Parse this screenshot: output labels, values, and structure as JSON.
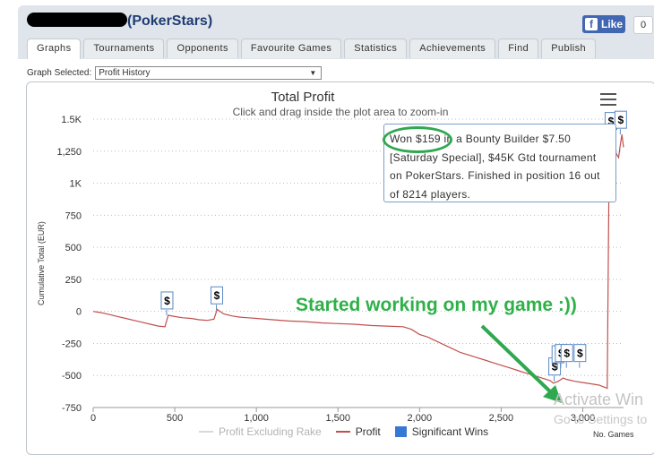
{
  "header": {
    "site_name": "(PokerStars)",
    "like_label": "Like",
    "like_count": "0",
    "fb_icon": "f"
  },
  "tabs": [
    {
      "label": "Graphs",
      "active": true
    },
    {
      "label": "Tournaments",
      "active": false
    },
    {
      "label": "Opponents",
      "active": false
    },
    {
      "label": "Favourite Games",
      "active": false
    },
    {
      "label": "Statistics",
      "active": false
    },
    {
      "label": "Achievements",
      "active": false
    },
    {
      "label": "Find",
      "active": false
    },
    {
      "label": "Publish",
      "active": false
    }
  ],
  "graph_selector": {
    "label": "Graph Selected:",
    "value": "Profit History"
  },
  "tooltip": {
    "text": "Won $159 in a Bounty Builder $7.50 [Saturday Special], $45K Gtd tournament on PokerStars. Finished in position 16 out of 8214 players."
  },
  "annotation": {
    "text": "Started working on my game :))"
  },
  "watermark": {
    "line1": "Activate Win",
    "line2": "Go to Settings to"
  },
  "chart_data": {
    "type": "line",
    "title": "Total Profit",
    "subtitle": "Click and drag inside the plot area to zoom-in",
    "xlabel": "No. Games",
    "ylabel": "Cumulative Total (EUR)",
    "xlim": [
      0,
      3250
    ],
    "ylim": [
      -750,
      1500
    ],
    "x_ticks": [
      0,
      500,
      1000,
      1500,
      2000,
      2500,
      3000
    ],
    "x_tick_labels": [
      "0",
      "500",
      "1,000",
      "1,500",
      "2,000",
      "2,500",
      "3,000"
    ],
    "y_ticks": [
      -750,
      -500,
      -250,
      0,
      250,
      500,
      750,
      1000,
      1250,
      1500
    ],
    "y_tick_labels": [
      "-750",
      "-500",
      "-250",
      "0",
      "250",
      "500",
      "750",
      "1K",
      "1,250",
      "1.5K"
    ],
    "grid": "horizontal dotted",
    "legend": [
      "Profit Excluding Rake",
      "Profit",
      "Significant Wins"
    ],
    "legend_position": "bottom-center",
    "series": [
      {
        "name": "Profit",
        "color": "#c0504d",
        "x": [
          0,
          50,
          100,
          150,
          200,
          250,
          300,
          350,
          400,
          440,
          460,
          500,
          550,
          600,
          650,
          700,
          740,
          760,
          800,
          850,
          900,
          950,
          1000,
          1100,
          1200,
          1300,
          1400,
          1500,
          1600,
          1700,
          1800,
          1900,
          1950,
          2000,
          2050,
          2100,
          2150,
          2200,
          2250,
          2300,
          2350,
          2400,
          2450,
          2500,
          2550,
          2600,
          2650,
          2700,
          2750,
          2800,
          2820,
          2850,
          2880,
          2900,
          2950,
          3000,
          3050,
          3100,
          3130,
          3150,
          3160,
          3170,
          3180,
          3200,
          3210,
          3220,
          3230,
          3240,
          3250
        ],
        "y": [
          0,
          -10,
          -25,
          -40,
          -55,
          -70,
          -85,
          -100,
          -115,
          -120,
          -30,
          -40,
          -50,
          -55,
          -65,
          -70,
          -60,
          15,
          -20,
          -35,
          -45,
          -50,
          -55,
          -65,
          -75,
          -80,
          -90,
          -95,
          -100,
          -110,
          -115,
          -120,
          -140,
          -180,
          -200,
          -230,
          -260,
          -290,
          -320,
          -340,
          -360,
          -380,
          -400,
          -420,
          -440,
          -460,
          -480,
          -500,
          -520,
          -540,
          -560,
          -545,
          -520,
          -530,
          -545,
          -555,
          -565,
          -575,
          -590,
          -600,
          900,
          1370,
          1300,
          1250,
          1220,
          1200,
          1300,
          1380,
          1280
        ]
      }
    ],
    "significant_wins": [
      {
        "x": 450,
        "y": -30,
        "label": "$"
      },
      {
        "x": 755,
        "y": 10,
        "label": "$"
      },
      {
        "x": 2825,
        "y": -545,
        "label": "$"
      },
      {
        "x": 2845,
        "y": -450,
        "label": "$"
      },
      {
        "x": 2865,
        "y": -440,
        "label": "$"
      },
      {
        "x": 2900,
        "y": -440,
        "label": "$"
      },
      {
        "x": 2980,
        "y": -440,
        "label": "$"
      },
      {
        "x": 3170,
        "y": 1370,
        "label": "$"
      },
      {
        "x": 3230,
        "y": 1380,
        "label": "$"
      }
    ]
  }
}
